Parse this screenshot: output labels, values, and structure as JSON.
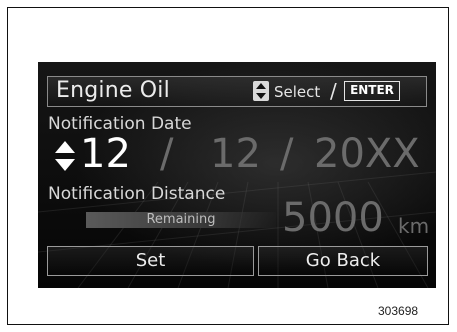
{
  "screen": {
    "title": "Engine Oil",
    "hint": {
      "updown_icon": "up-down-arrow-icon",
      "select_label": "Select",
      "separator": "/",
      "enter_label": "ENTER"
    },
    "notification_date": {
      "label": "Notification Date",
      "month": "12",
      "separator": "/",
      "day": "12",
      "year": "20XX"
    },
    "notification_distance": {
      "label": "Notification Distance",
      "remaining_label": "Remaining",
      "value": "5000",
      "unit": "km"
    },
    "buttons": {
      "set_label": "Set",
      "back_label": "Go Back"
    }
  },
  "figure_number": "303698"
}
